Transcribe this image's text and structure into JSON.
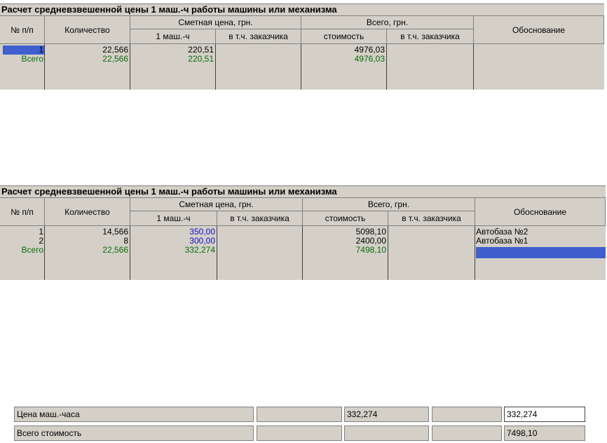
{
  "table1": {
    "title": "Расчет средневзвешенной цены 1 маш.-ч работы машины или механизма",
    "headers": {
      "num": "№ п/п",
      "qty": "Количество",
      "price_group": "Сметная цена, грн.",
      "price_unit": "1 маш.-ч",
      "price_customer": "в т.ч. заказчика",
      "total_group": "Всего, грн.",
      "total_cost": "стоимость",
      "total_customer": "в т.ч. заказчика",
      "basis": "Обоснование"
    },
    "rows": [
      {
        "num": "1",
        "qty": "22,566",
        "price": "220,51",
        "price_customer": "",
        "cost": "4976,03",
        "cost_customer": "",
        "basis": ""
      }
    ],
    "total": {
      "label": "Всего",
      "qty": "22,566",
      "price": "220,51",
      "cost": "4976,03"
    }
  },
  "table2": {
    "title": "Расчет средневзвешенной цены 1 маш.-ч работы машины или механизма",
    "headers": {
      "num": "№ п/п",
      "qty": "Количество",
      "price_group": "Сметная цена, грн.",
      "price_unit": "1 маш.-ч",
      "price_customer": "в т.ч. заказчика",
      "total_group": "Всего, грн.",
      "total_cost": "стоимость",
      "total_customer": "в т.ч. заказчика",
      "basis": "Обоснование"
    },
    "rows": [
      {
        "num": "1",
        "qty": "14,566",
        "price": "350,00",
        "price_customer": "",
        "cost": "5098,10",
        "cost_customer": "",
        "basis": "Автобаза №2"
      },
      {
        "num": "2",
        "qty": "8",
        "price": "300,00",
        "price_customer": "",
        "cost": "2400,00",
        "cost_customer": "",
        "basis": "Автобаза №1"
      }
    ],
    "total": {
      "label": "Всего",
      "qty": "22,566",
      "price": "332,274",
      "cost": "7498,10"
    }
  },
  "summary": {
    "row1": {
      "label": "Цена маш.-часа",
      "value_mid": "332,274",
      "value_edit": "332,274"
    },
    "row2": {
      "label": "Всего стоимость",
      "value_edit": "7498,10"
    }
  }
}
